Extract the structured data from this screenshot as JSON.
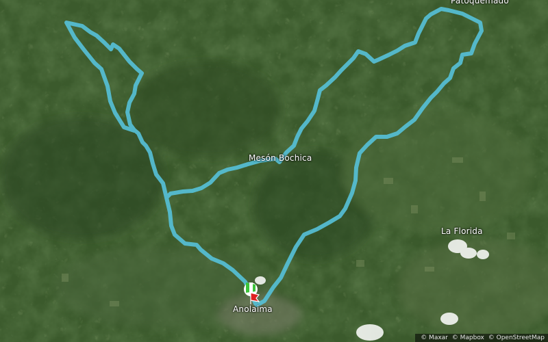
{
  "map": {
    "basemap": "satellite",
    "colors": {
      "route": "#56bfd6",
      "start_flag": "#3cc43a",
      "end_flag": "#e02020"
    },
    "places": {
      "patoquemado": "Patoquemado",
      "meson_bochica": "Mesón Bochica",
      "la_florida": "La Florida",
      "anolaima": "Anolaima"
    },
    "attribution": [
      "© Maxar",
      "© Mapbox",
      "© OpenStreetMap"
    ]
  }
}
